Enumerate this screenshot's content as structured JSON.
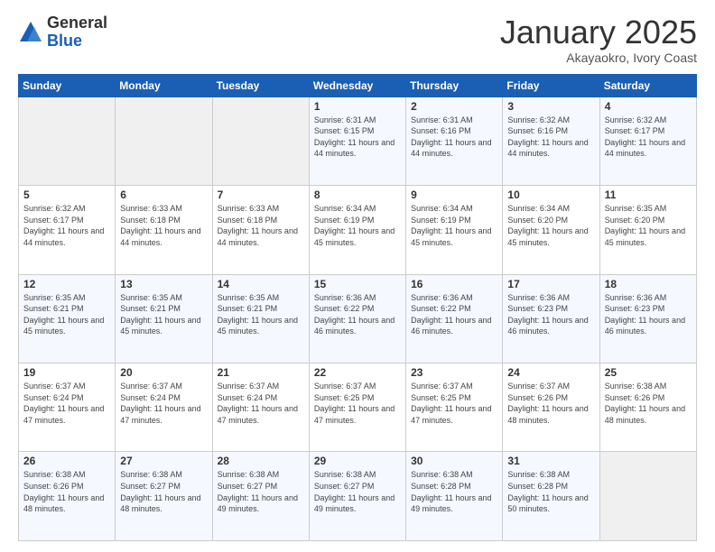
{
  "logo": {
    "general": "General",
    "blue": "Blue"
  },
  "header": {
    "month": "January 2025",
    "location": "Akayaokro, Ivory Coast"
  },
  "days_of_week": [
    "Sunday",
    "Monday",
    "Tuesday",
    "Wednesday",
    "Thursday",
    "Friday",
    "Saturday"
  ],
  "weeks": [
    [
      {
        "num": "",
        "info": ""
      },
      {
        "num": "",
        "info": ""
      },
      {
        "num": "",
        "info": ""
      },
      {
        "num": "1",
        "info": "Sunrise: 6:31 AM\nSunset: 6:15 PM\nDaylight: 11 hours and 44 minutes."
      },
      {
        "num": "2",
        "info": "Sunrise: 6:31 AM\nSunset: 6:16 PM\nDaylight: 11 hours and 44 minutes."
      },
      {
        "num": "3",
        "info": "Sunrise: 6:32 AM\nSunset: 6:16 PM\nDaylight: 11 hours and 44 minutes."
      },
      {
        "num": "4",
        "info": "Sunrise: 6:32 AM\nSunset: 6:17 PM\nDaylight: 11 hours and 44 minutes."
      }
    ],
    [
      {
        "num": "5",
        "info": "Sunrise: 6:32 AM\nSunset: 6:17 PM\nDaylight: 11 hours and 44 minutes."
      },
      {
        "num": "6",
        "info": "Sunrise: 6:33 AM\nSunset: 6:18 PM\nDaylight: 11 hours and 44 minutes."
      },
      {
        "num": "7",
        "info": "Sunrise: 6:33 AM\nSunset: 6:18 PM\nDaylight: 11 hours and 44 minutes."
      },
      {
        "num": "8",
        "info": "Sunrise: 6:34 AM\nSunset: 6:19 PM\nDaylight: 11 hours and 45 minutes."
      },
      {
        "num": "9",
        "info": "Sunrise: 6:34 AM\nSunset: 6:19 PM\nDaylight: 11 hours and 45 minutes."
      },
      {
        "num": "10",
        "info": "Sunrise: 6:34 AM\nSunset: 6:20 PM\nDaylight: 11 hours and 45 minutes."
      },
      {
        "num": "11",
        "info": "Sunrise: 6:35 AM\nSunset: 6:20 PM\nDaylight: 11 hours and 45 minutes."
      }
    ],
    [
      {
        "num": "12",
        "info": "Sunrise: 6:35 AM\nSunset: 6:21 PM\nDaylight: 11 hours and 45 minutes."
      },
      {
        "num": "13",
        "info": "Sunrise: 6:35 AM\nSunset: 6:21 PM\nDaylight: 11 hours and 45 minutes."
      },
      {
        "num": "14",
        "info": "Sunrise: 6:35 AM\nSunset: 6:21 PM\nDaylight: 11 hours and 45 minutes."
      },
      {
        "num": "15",
        "info": "Sunrise: 6:36 AM\nSunset: 6:22 PM\nDaylight: 11 hours and 46 minutes."
      },
      {
        "num": "16",
        "info": "Sunrise: 6:36 AM\nSunset: 6:22 PM\nDaylight: 11 hours and 46 minutes."
      },
      {
        "num": "17",
        "info": "Sunrise: 6:36 AM\nSunset: 6:23 PM\nDaylight: 11 hours and 46 minutes."
      },
      {
        "num": "18",
        "info": "Sunrise: 6:36 AM\nSunset: 6:23 PM\nDaylight: 11 hours and 46 minutes."
      }
    ],
    [
      {
        "num": "19",
        "info": "Sunrise: 6:37 AM\nSunset: 6:24 PM\nDaylight: 11 hours and 47 minutes."
      },
      {
        "num": "20",
        "info": "Sunrise: 6:37 AM\nSunset: 6:24 PM\nDaylight: 11 hours and 47 minutes."
      },
      {
        "num": "21",
        "info": "Sunrise: 6:37 AM\nSunset: 6:24 PM\nDaylight: 11 hours and 47 minutes."
      },
      {
        "num": "22",
        "info": "Sunrise: 6:37 AM\nSunset: 6:25 PM\nDaylight: 11 hours and 47 minutes."
      },
      {
        "num": "23",
        "info": "Sunrise: 6:37 AM\nSunset: 6:25 PM\nDaylight: 11 hours and 47 minutes."
      },
      {
        "num": "24",
        "info": "Sunrise: 6:37 AM\nSunset: 6:26 PM\nDaylight: 11 hours and 48 minutes."
      },
      {
        "num": "25",
        "info": "Sunrise: 6:38 AM\nSunset: 6:26 PM\nDaylight: 11 hours and 48 minutes."
      }
    ],
    [
      {
        "num": "26",
        "info": "Sunrise: 6:38 AM\nSunset: 6:26 PM\nDaylight: 11 hours and 48 minutes."
      },
      {
        "num": "27",
        "info": "Sunrise: 6:38 AM\nSunset: 6:27 PM\nDaylight: 11 hours and 48 minutes."
      },
      {
        "num": "28",
        "info": "Sunrise: 6:38 AM\nSunset: 6:27 PM\nDaylight: 11 hours and 49 minutes."
      },
      {
        "num": "29",
        "info": "Sunrise: 6:38 AM\nSunset: 6:27 PM\nDaylight: 11 hours and 49 minutes."
      },
      {
        "num": "30",
        "info": "Sunrise: 6:38 AM\nSunset: 6:28 PM\nDaylight: 11 hours and 49 minutes."
      },
      {
        "num": "31",
        "info": "Sunrise: 6:38 AM\nSunset: 6:28 PM\nDaylight: 11 hours and 50 minutes."
      },
      {
        "num": "",
        "info": ""
      }
    ]
  ]
}
